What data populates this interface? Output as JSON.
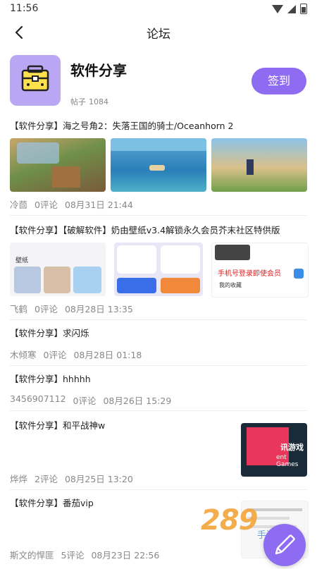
{
  "status": {
    "time": "11:56"
  },
  "header": {
    "title": "论坛"
  },
  "forum": {
    "name": "软件分享",
    "posts_label": "帖子",
    "posts_count": "1084",
    "checkin_label": "签到"
  },
  "posts": [
    {
      "title": "【软件分享】海之号角2：失落王国的骑士/Oceanhorn 2",
      "author": "冷茴",
      "comments": "0评论",
      "date": "08月31日 21:44"
    },
    {
      "title": "【软件分享】【破解软件】奶由壁纸v3.4解锁永久会员芥末社区特供版",
      "author": "飞鹤",
      "comments": "0评论",
      "date": "08月28日 13:35",
      "img_texts": {
        "wallpaper": "壁纸",
        "phone_login": "手机号登录即使会员",
        "my_favorites": "我的收藏"
      }
    },
    {
      "title": "【软件分享】求闪烁",
      "author": "木倾寒",
      "comments": "0评论",
      "date": "08月28日 01:18"
    },
    {
      "title": "【软件分享】hhhhh",
      "author": "3456907112",
      "comments": "0评论",
      "date": "08月26日 15:29"
    },
    {
      "title": "【软件分享】和平战神w",
      "author": "烨烨",
      "comments": "2评论",
      "date": "08月25日 13:20",
      "img_texts": {
        "cn": "讯游戏",
        "en": "ent Games"
      }
    },
    {
      "title": "【软件分享】番茄vip",
      "author": "斯文的悍匪",
      "comments": "5评论",
      "date": "08月23日 22:56"
    }
  ],
  "watermark": {
    "logo": "289",
    "sub": "手游网"
  },
  "colors": {
    "accent": "#8e6cf2",
    "forum_icon_bg": "#b9a7f3"
  }
}
